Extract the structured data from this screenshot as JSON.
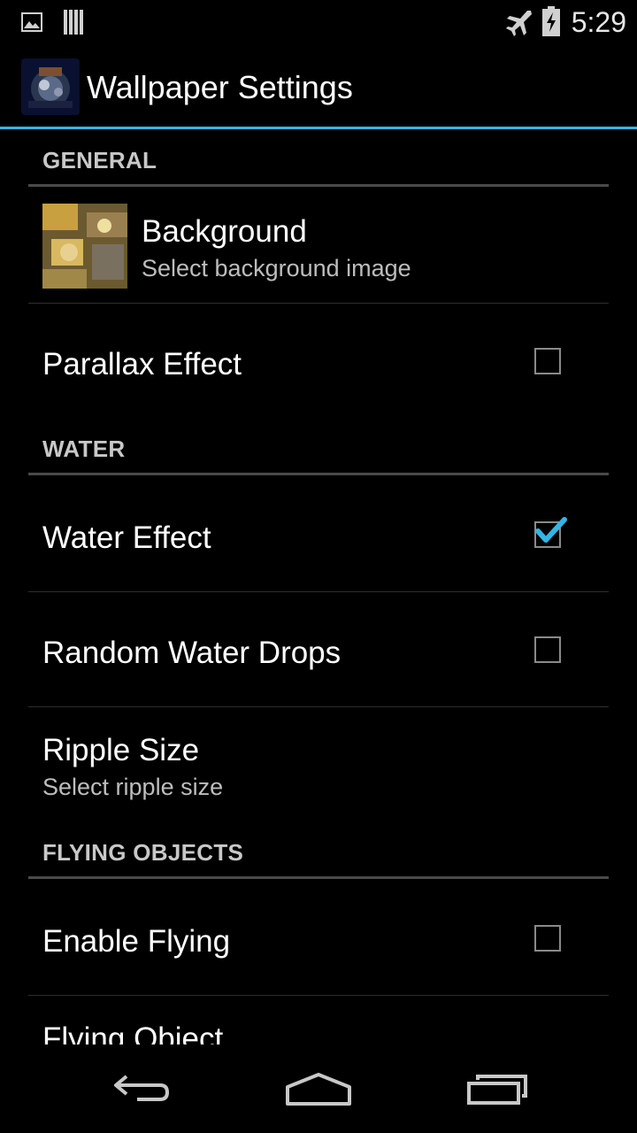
{
  "status_bar": {
    "time": "5:29",
    "left_icons": [
      "gallery-icon",
      "barcode-icon"
    ],
    "right_icons": [
      "airplane-mode-icon",
      "battery-charging-icon"
    ]
  },
  "action_bar": {
    "title": "Wallpaper Settings",
    "accent_color": "#33b5e5"
  },
  "sections": {
    "general": {
      "header": "GENERAL",
      "background": {
        "title": "Background",
        "summary": "Select background image"
      },
      "parallax": {
        "title": "Parallax Effect",
        "checked": false
      }
    },
    "water": {
      "header": "WATER",
      "water_effect": {
        "title": "Water Effect",
        "checked": true
      },
      "random_drops": {
        "title": "Random Water Drops",
        "checked": false
      },
      "ripple_size": {
        "title": "Ripple Size",
        "summary": "Select ripple size"
      }
    },
    "flying": {
      "header": "FLYING OBJECTS",
      "enable_flying": {
        "title": "Enable Flying",
        "checked": false
      },
      "flying_object": {
        "title": "Flying Object"
      }
    }
  },
  "nav_bar": {
    "buttons": [
      "back-icon",
      "home-icon",
      "recent-apps-icon"
    ]
  }
}
